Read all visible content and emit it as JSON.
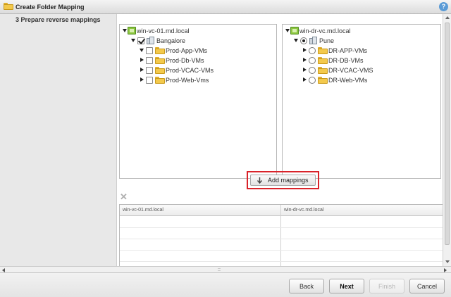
{
  "window": {
    "title": "Create Folder Mapping",
    "help_label": "?"
  },
  "sidebar": {
    "current_step": "3  Prepare reverse mappings"
  },
  "left_tree": {
    "root": "win-vc-01.md.local",
    "datacenter": "Bangalore",
    "folders": [
      "Prod-App-VMs",
      "Prod-Db-VMs",
      "Prod-VCAC-VMs",
      "Prod-Web-Vms"
    ]
  },
  "right_tree": {
    "root": "win-dr-vc.md.local",
    "datacenter": "Pune",
    "folders": [
      "DR-APP-VMs",
      "DR-DB-VMs",
      "DR-VCAC-VMS",
      "DR-Web-VMs"
    ]
  },
  "add_mappings_label": "Add mappings",
  "remove_label": "✕",
  "grid": {
    "columns": [
      "win-vc-01.md.local",
      "win-dr-vc.md.local"
    ]
  },
  "hscroll_grip": "::",
  "footer": {
    "back": "Back",
    "next": "Next",
    "finish": "Finish",
    "cancel": "Cancel"
  }
}
